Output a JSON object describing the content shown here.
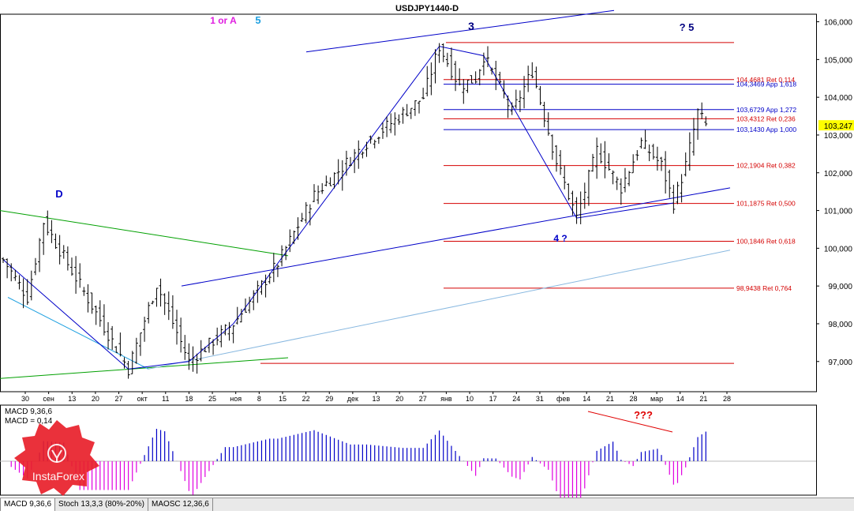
{
  "chart_data": {
    "type": "candlestick",
    "title": "USDJPY1440-D",
    "price_axis": {
      "ylim": [
        96.2,
        106.2
      ],
      "ticks": [
        "106,000",
        "105,000",
        "104,000",
        "103,000",
        "102,000",
        "101,000",
        "100,000",
        "99,000",
        "98,000",
        "97,000"
      ],
      "current_price": "103,247"
    },
    "time_axis": {
      "ticks": [
        "30",
        "сен",
        "13",
        "20",
        "27",
        "окт",
        "11",
        "18",
        "25",
        "ноя",
        "8",
        "15",
        "22",
        "29",
        "дек",
        "13",
        "20",
        "27",
        "янв",
        "10",
        "17",
        "24",
        "31",
        "фев",
        "14",
        "21",
        "28",
        "мар",
        "14",
        "21",
        "28"
      ]
    },
    "levels": [
      {
        "label": "104,4681 Ret 0,114",
        "price": 104.468,
        "color": "#d40000",
        "kind": "ret"
      },
      {
        "label": "104,3469 App 1,618",
        "price": 104.347,
        "color": "#0000c8",
        "kind": "app"
      },
      {
        "label": "103,6729 App 1,272",
        "price": 103.673,
        "color": "#0000c8",
        "kind": "app"
      },
      {
        "label": "103,4312 Ret 0,236",
        "price": 103.431,
        "color": "#d40000",
        "kind": "ret"
      },
      {
        "label": "103,1430 App 1,000",
        "price": 103.143,
        "color": "#0000c8",
        "kind": "app"
      },
      {
        "label": "102,1904 Ret 0,382",
        "price": 102.19,
        "color": "#d40000",
        "kind": "ret"
      },
      {
        "label": "101,1875 Ret 0,500",
        "price": 101.1875,
        "color": "#d40000",
        "kind": "ret"
      },
      {
        "label": "100,1846 Ret 0,618",
        "price": 100.1846,
        "color": "#d40000",
        "kind": "ret"
      },
      {
        "label": "98,9438 Ret 0,764",
        "price": 98.9438,
        "color": "#d40000",
        "kind": "ret"
      }
    ],
    "top_levels": [
      {
        "price": 105.45,
        "color": "#d40000"
      },
      {
        "price": 96.95,
        "color": "#d40000"
      }
    ],
    "wave_pivots": [
      {
        "bar": 0,
        "price": 99.7
      },
      {
        "bar": 6,
        "price": 98.7
      },
      {
        "bar": 10,
        "price": 100.7
      },
      {
        "bar": 31,
        "price": 96.8
      },
      {
        "bar": 38,
        "price": 99.05
      },
      {
        "bar": 46,
        "price": 97.0
      },
      {
        "bar": 57,
        "price": 98.0
      },
      {
        "bar": 68,
        "price": 99.6
      },
      {
        "bar": 77,
        "price": 101.4
      },
      {
        "bar": 90,
        "price": 102.8
      },
      {
        "bar": 104,
        "price": 104.0
      },
      {
        "bar": 108,
        "price": 105.35
      },
      {
        "bar": 113,
        "price": 104.3
      },
      {
        "bar": 117,
        "price": 104.5
      },
      {
        "bar": 119,
        "price": 105.1
      },
      {
        "bar": 126,
        "price": 103.6
      },
      {
        "bar": 131,
        "price": 104.7
      },
      {
        "bar": 137,
        "price": 102.3
      },
      {
        "bar": 142,
        "price": 100.8
      },
      {
        "bar": 147,
        "price": 102.6
      },
      {
        "bar": 153,
        "price": 101.6
      },
      {
        "bar": 158,
        "price": 102.8
      },
      {
        "bar": 163,
        "price": 102.2
      },
      {
        "bar": 166,
        "price": 101.2
      },
      {
        "bar": 169,
        "price": 102.2
      },
      {
        "bar": 172,
        "price": 103.6
      },
      {
        "bar": 174,
        "price": 103.25
      }
    ],
    "wave_labels": [
      {
        "text": "1 or A",
        "color": "#e020e0",
        "bold": true
      },
      {
        "text": "5",
        "color": "#1ea0e0",
        "bold": true
      },
      {
        "text": "? 5",
        "color": "#000080",
        "bold": true
      },
      {
        "text": "3",
        "color": "#000080",
        "bold": true
      },
      {
        "text": "D",
        "color": "#0000c8",
        "bold": true
      },
      {
        "text": "4 ?",
        "color": "#0000c8",
        "bold": true
      },
      {
        "text": "???",
        "color": "#e00000",
        "bold": true
      }
    ],
    "indicator": {
      "name": "MACD 9,36,6",
      "labels": [
        "MACD 9,36,6",
        "MACD = 0,14"
      ],
      "bars_color_pos": "#0000c8",
      "bars_color_neg": "#e000e0"
    },
    "grid": false
  },
  "tabs": [
    {
      "label": "MACD 9,36,6"
    },
    {
      "label": "Stoch 13,3,3 (80%-20%)"
    },
    {
      "label": "MAOSC 12,36,6"
    }
  ],
  "logo_text": "InstaForex"
}
